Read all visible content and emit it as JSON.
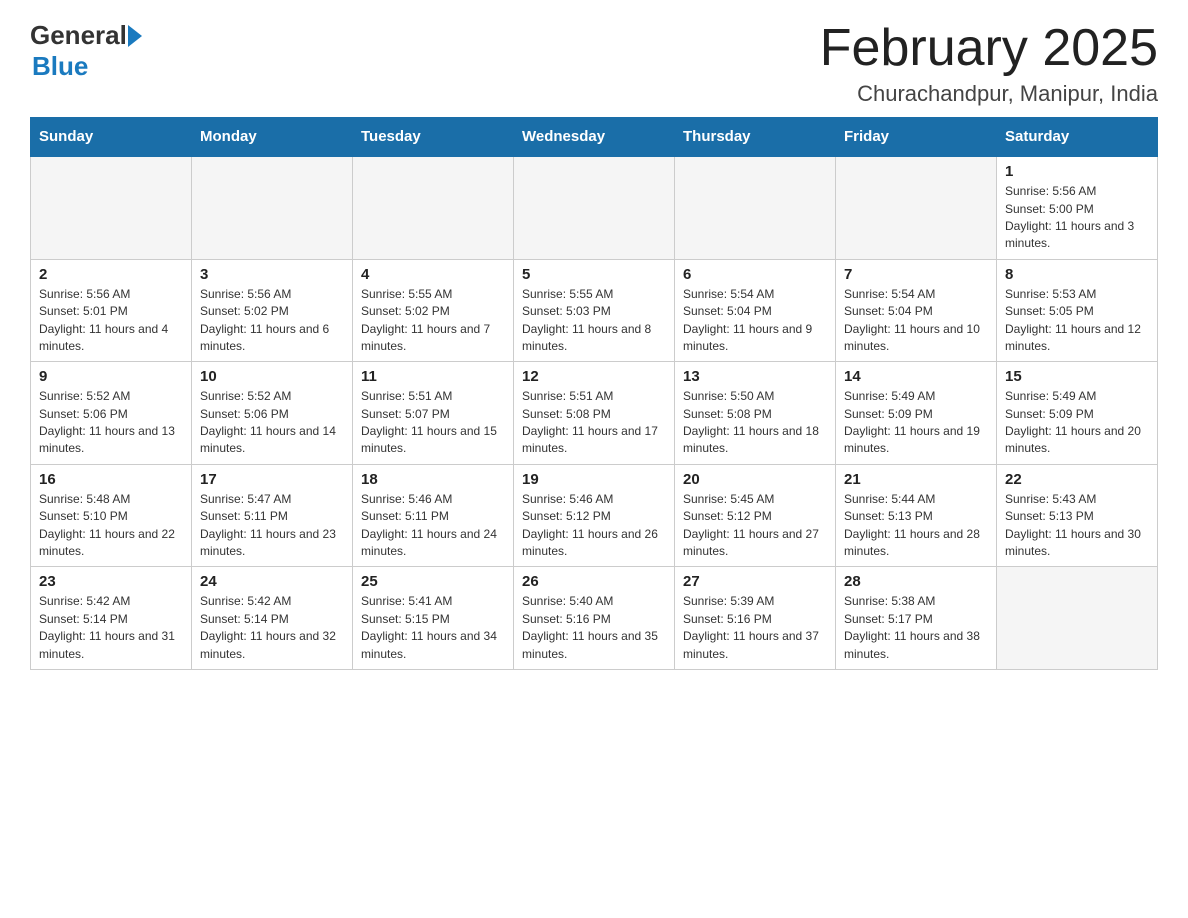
{
  "header": {
    "logo_general": "General",
    "logo_blue": "Blue",
    "month_title": "February 2025",
    "location": "Churachandpur, Manipur, India"
  },
  "weekdays": [
    "Sunday",
    "Monday",
    "Tuesday",
    "Wednesday",
    "Thursday",
    "Friday",
    "Saturday"
  ],
  "weeks": [
    [
      {
        "day": "",
        "info": ""
      },
      {
        "day": "",
        "info": ""
      },
      {
        "day": "",
        "info": ""
      },
      {
        "day": "",
        "info": ""
      },
      {
        "day": "",
        "info": ""
      },
      {
        "day": "",
        "info": ""
      },
      {
        "day": "1",
        "info": "Sunrise: 5:56 AM\nSunset: 5:00 PM\nDaylight: 11 hours and 3 minutes."
      }
    ],
    [
      {
        "day": "2",
        "info": "Sunrise: 5:56 AM\nSunset: 5:01 PM\nDaylight: 11 hours and 4 minutes."
      },
      {
        "day": "3",
        "info": "Sunrise: 5:56 AM\nSunset: 5:02 PM\nDaylight: 11 hours and 6 minutes."
      },
      {
        "day": "4",
        "info": "Sunrise: 5:55 AM\nSunset: 5:02 PM\nDaylight: 11 hours and 7 minutes."
      },
      {
        "day": "5",
        "info": "Sunrise: 5:55 AM\nSunset: 5:03 PM\nDaylight: 11 hours and 8 minutes."
      },
      {
        "day": "6",
        "info": "Sunrise: 5:54 AM\nSunset: 5:04 PM\nDaylight: 11 hours and 9 minutes."
      },
      {
        "day": "7",
        "info": "Sunrise: 5:54 AM\nSunset: 5:04 PM\nDaylight: 11 hours and 10 minutes."
      },
      {
        "day": "8",
        "info": "Sunrise: 5:53 AM\nSunset: 5:05 PM\nDaylight: 11 hours and 12 minutes."
      }
    ],
    [
      {
        "day": "9",
        "info": "Sunrise: 5:52 AM\nSunset: 5:06 PM\nDaylight: 11 hours and 13 minutes."
      },
      {
        "day": "10",
        "info": "Sunrise: 5:52 AM\nSunset: 5:06 PM\nDaylight: 11 hours and 14 minutes."
      },
      {
        "day": "11",
        "info": "Sunrise: 5:51 AM\nSunset: 5:07 PM\nDaylight: 11 hours and 15 minutes."
      },
      {
        "day": "12",
        "info": "Sunrise: 5:51 AM\nSunset: 5:08 PM\nDaylight: 11 hours and 17 minutes."
      },
      {
        "day": "13",
        "info": "Sunrise: 5:50 AM\nSunset: 5:08 PM\nDaylight: 11 hours and 18 minutes."
      },
      {
        "day": "14",
        "info": "Sunrise: 5:49 AM\nSunset: 5:09 PM\nDaylight: 11 hours and 19 minutes."
      },
      {
        "day": "15",
        "info": "Sunrise: 5:49 AM\nSunset: 5:09 PM\nDaylight: 11 hours and 20 minutes."
      }
    ],
    [
      {
        "day": "16",
        "info": "Sunrise: 5:48 AM\nSunset: 5:10 PM\nDaylight: 11 hours and 22 minutes."
      },
      {
        "day": "17",
        "info": "Sunrise: 5:47 AM\nSunset: 5:11 PM\nDaylight: 11 hours and 23 minutes."
      },
      {
        "day": "18",
        "info": "Sunrise: 5:46 AM\nSunset: 5:11 PM\nDaylight: 11 hours and 24 minutes."
      },
      {
        "day": "19",
        "info": "Sunrise: 5:46 AM\nSunset: 5:12 PM\nDaylight: 11 hours and 26 minutes."
      },
      {
        "day": "20",
        "info": "Sunrise: 5:45 AM\nSunset: 5:12 PM\nDaylight: 11 hours and 27 minutes."
      },
      {
        "day": "21",
        "info": "Sunrise: 5:44 AM\nSunset: 5:13 PM\nDaylight: 11 hours and 28 minutes."
      },
      {
        "day": "22",
        "info": "Sunrise: 5:43 AM\nSunset: 5:13 PM\nDaylight: 11 hours and 30 minutes."
      }
    ],
    [
      {
        "day": "23",
        "info": "Sunrise: 5:42 AM\nSunset: 5:14 PM\nDaylight: 11 hours and 31 minutes."
      },
      {
        "day": "24",
        "info": "Sunrise: 5:42 AM\nSunset: 5:14 PM\nDaylight: 11 hours and 32 minutes."
      },
      {
        "day": "25",
        "info": "Sunrise: 5:41 AM\nSunset: 5:15 PM\nDaylight: 11 hours and 34 minutes."
      },
      {
        "day": "26",
        "info": "Sunrise: 5:40 AM\nSunset: 5:16 PM\nDaylight: 11 hours and 35 minutes."
      },
      {
        "day": "27",
        "info": "Sunrise: 5:39 AM\nSunset: 5:16 PM\nDaylight: 11 hours and 37 minutes."
      },
      {
        "day": "28",
        "info": "Sunrise: 5:38 AM\nSunset: 5:17 PM\nDaylight: 11 hours and 38 minutes."
      },
      {
        "day": "",
        "info": ""
      }
    ]
  ]
}
